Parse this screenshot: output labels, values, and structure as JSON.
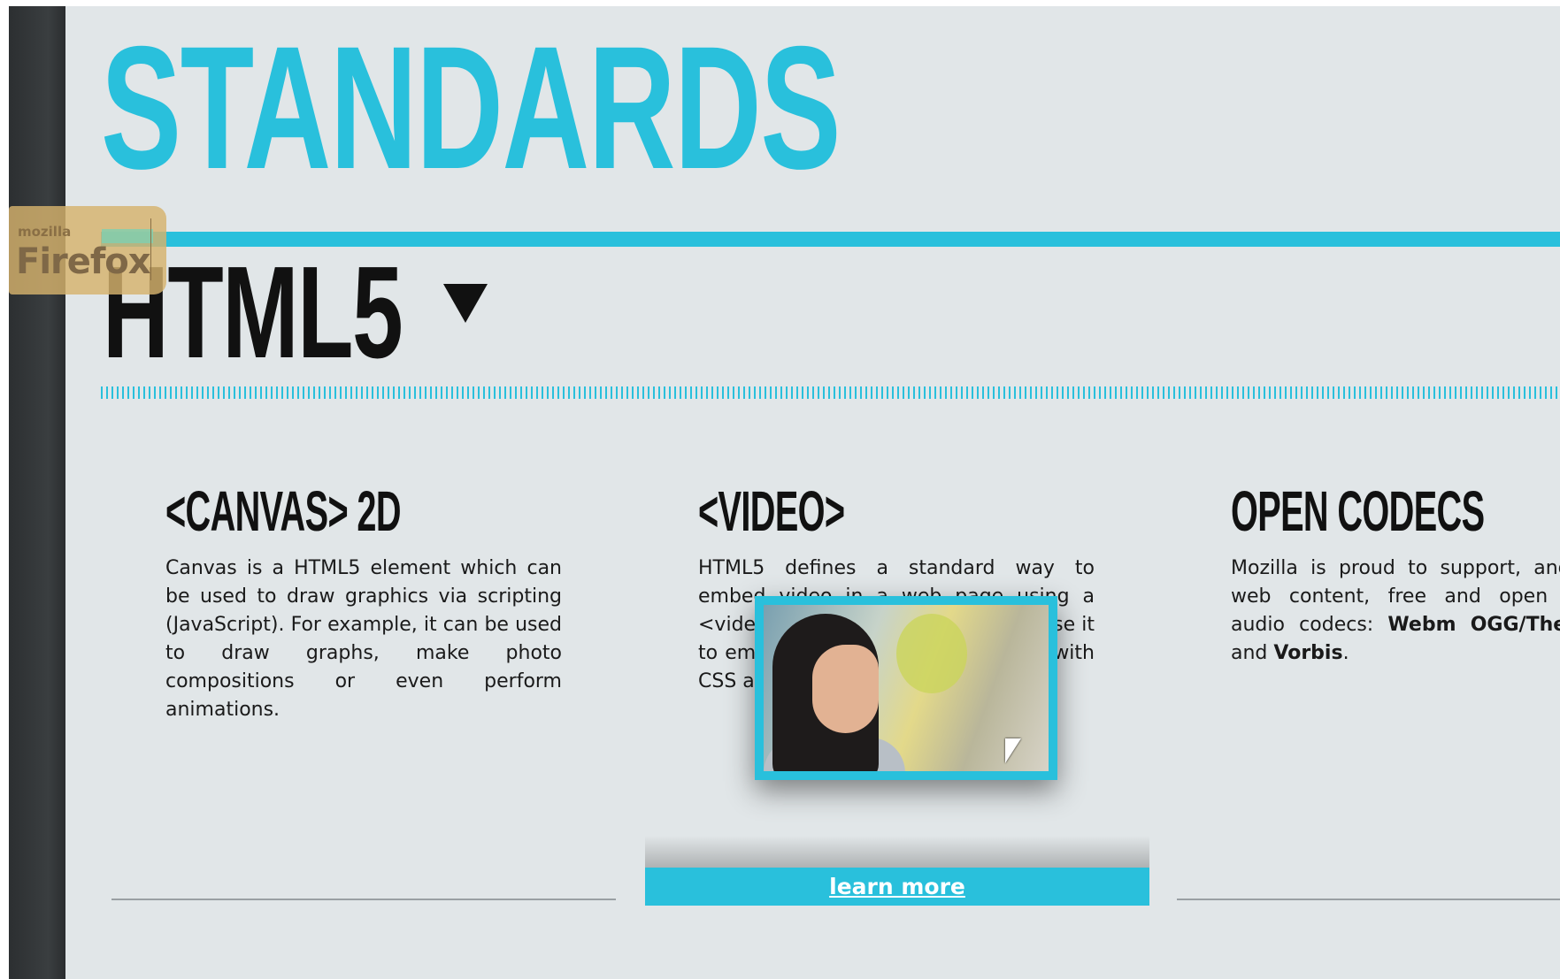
{
  "page": {
    "title": "STANDARDS",
    "section_title": "HTML5",
    "section_toggle_icon": "triangle-down-icon"
  },
  "badge": {
    "line1": "mozilla",
    "line2": "Firefox"
  },
  "columns": [
    {
      "heading": "<CANVAS> 2D",
      "body": "Canvas is a HTML5 element which can be used to draw graphics via scripting (JavaScript). For example, it can be used to draw graphs, make photo compositions or even perform animations."
    },
    {
      "heading": "<VIDEO>",
      "body": "HTML5 defines a standard way to embed video in a web page using a <video> element. Developers can use it to embed video and now use video with CSS and JavaScript."
    },
    {
      "heading": "OPEN CODECS",
      "body_pre": "Mozilla is proud to support, and to web content, free and open and audio codecs: ",
      "codec1": "Webm",
      "codec2": "OGG/Theora",
      "body_and": " and ",
      "codec3": "Vorbis",
      "body_end": "."
    }
  ],
  "learn_more_label": "learn more",
  "colors": {
    "accent": "#29c0dc",
    "background": "#e1e6e8",
    "sidebar": "#2c2f31",
    "text": "#111111"
  }
}
